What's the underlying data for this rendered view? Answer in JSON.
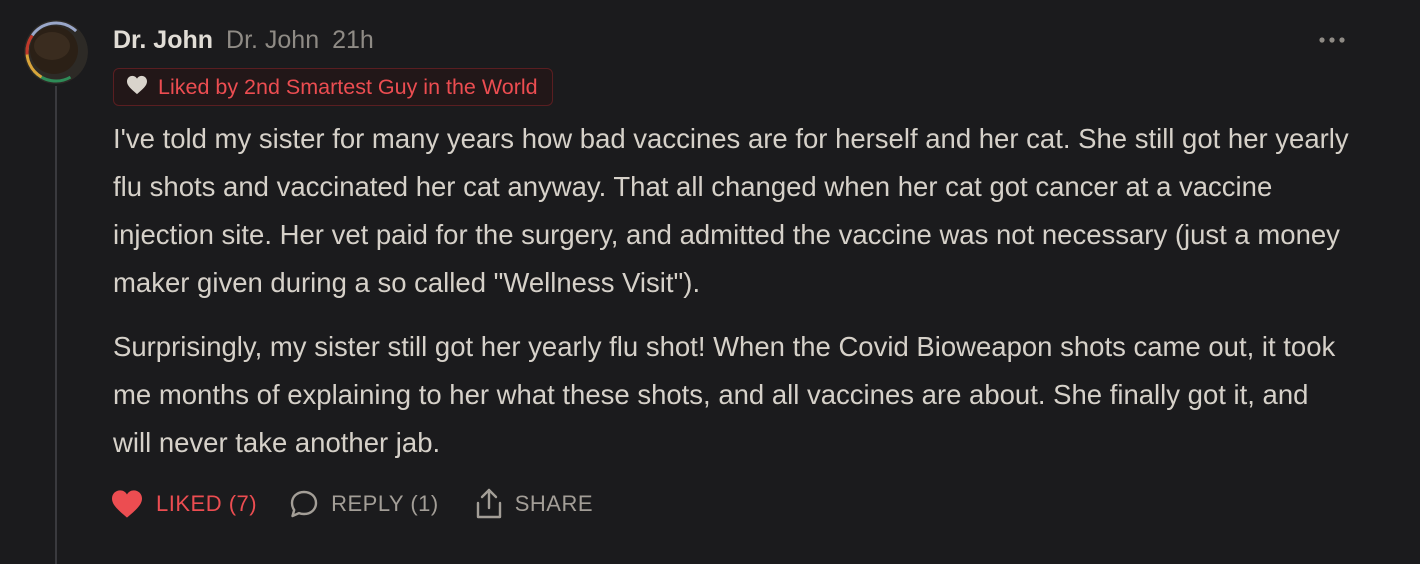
{
  "comment": {
    "author_name": "Dr. John",
    "handle": "Dr. John",
    "timestamp": "21h",
    "liked_by_text": "Liked by 2nd Smartest Guy in the World",
    "paragraphs": [
      "I've told my sister for many years how bad vaccines are for herself and her cat. She still got her yearly flu shots and vaccinated her cat anyway. That all changed when her cat got cancer at a vaccine injection site. Her vet paid for the surgery, and admitted the vaccine was not necessary (just a money maker given during a so called \"Wellness Visit\").",
      "Surprisingly, my sister still got her yearly flu shot! When the Covid Bioweapon shots came out, it took me months of explaining to her what these shots, and all vaccines are about. She finally got it, and will never take another jab."
    ]
  },
  "actions": {
    "like_label": "LIKED (7)",
    "reply_label": "REPLY (1)",
    "share_label": "SHARE"
  },
  "icons": {
    "avatar": "avatar-image",
    "badge": "heart-icon",
    "like": "heart-filled-icon",
    "reply": "speech-bubble-icon",
    "share": "share-upload-icon",
    "more": "more-dots-icon"
  },
  "colors": {
    "background": "#1b1b1d",
    "text": "#d6d1c9",
    "muted": "#8f8b85",
    "accent_red": "#ec4d51",
    "badge_border": "#5a1e21"
  }
}
